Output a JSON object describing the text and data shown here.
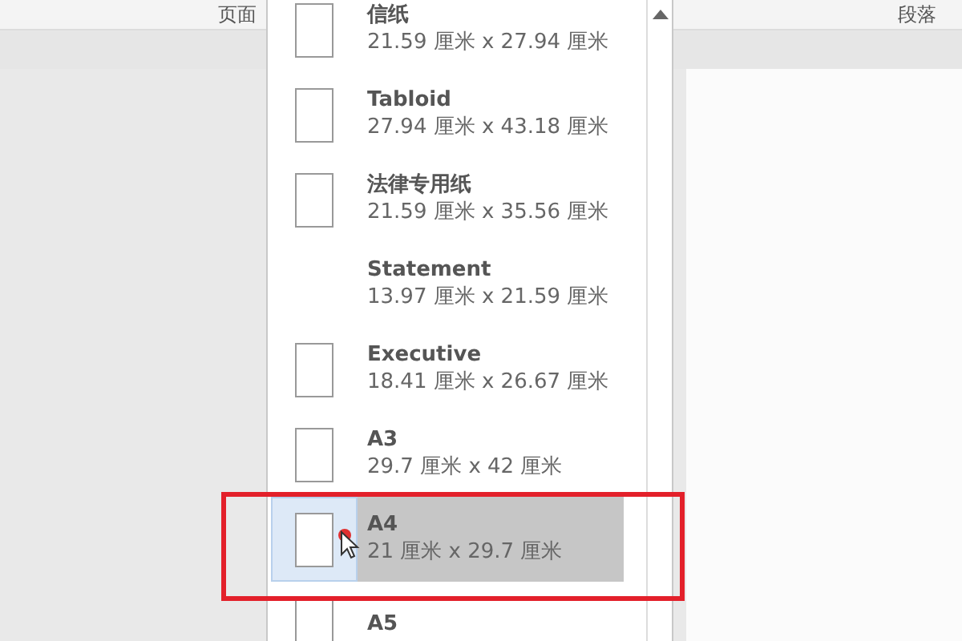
{
  "ribbon": {
    "groups": [
      {
        "label": "页面"
      },
      {
        "label": "段落"
      }
    ]
  },
  "paper_menu": {
    "items": [
      {
        "name": "信纸",
        "size": "21.59 厘米 x 27.94 厘米",
        "icon": true,
        "selected": false
      },
      {
        "name": "Tabloid",
        "size": "27.94 厘米 x 43.18 厘米",
        "icon": true,
        "selected": false
      },
      {
        "name": "法律专用纸",
        "size": "21.59 厘米 x 35.56 厘米",
        "icon": true,
        "selected": false
      },
      {
        "name": "Statement",
        "size": "13.97 厘米 x 21.59 厘米",
        "icon": false,
        "selected": false
      },
      {
        "name": "Executive",
        "size": "18.41 厘米 x 26.67 厘米",
        "icon": true,
        "selected": false
      },
      {
        "name": "A3",
        "size": "29.7 厘米 x 42 厘米",
        "icon": true,
        "selected": false
      },
      {
        "name": "A4",
        "size": "21 厘米 x 29.7 厘米",
        "icon": true,
        "selected": true
      },
      {
        "name": "A5",
        "icon": true,
        "selected": false
      }
    ]
  }
}
